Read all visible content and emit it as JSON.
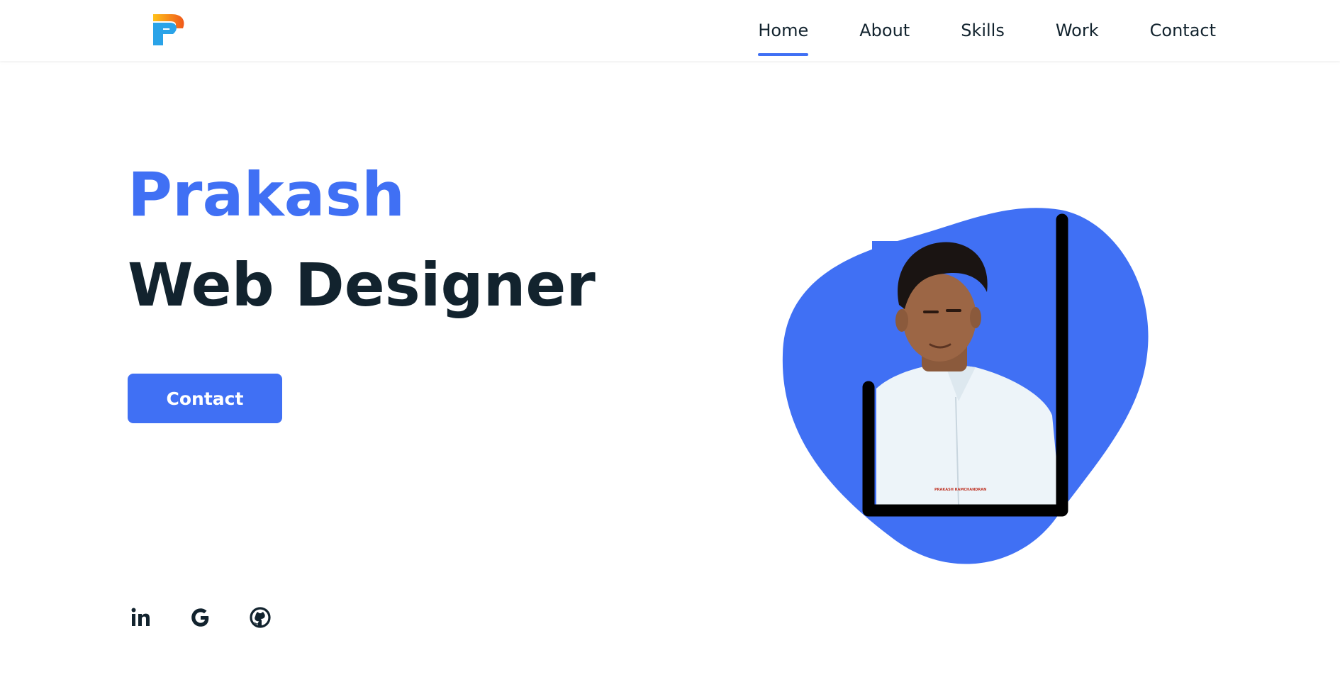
{
  "header": {
    "logo_icon": "p-logo-icon",
    "nav": [
      {
        "label": "Home",
        "active": true
      },
      {
        "label": "About",
        "active": false
      },
      {
        "label": "Skills",
        "active": false
      },
      {
        "label": "Work",
        "active": false
      },
      {
        "label": "Contact",
        "active": false
      }
    ]
  },
  "hero": {
    "name": "Prakash",
    "role": "Web Designer",
    "button_label": "Contact",
    "image_caption": "PRAKASH RAMCHANDRAN"
  },
  "social": [
    {
      "icon": "linkedin-icon"
    },
    {
      "icon": "google-icon"
    },
    {
      "icon": "github-icon"
    }
  ],
  "colors": {
    "accent": "#4070f4",
    "text_dark": "#12232e",
    "background": "#ffffff"
  }
}
